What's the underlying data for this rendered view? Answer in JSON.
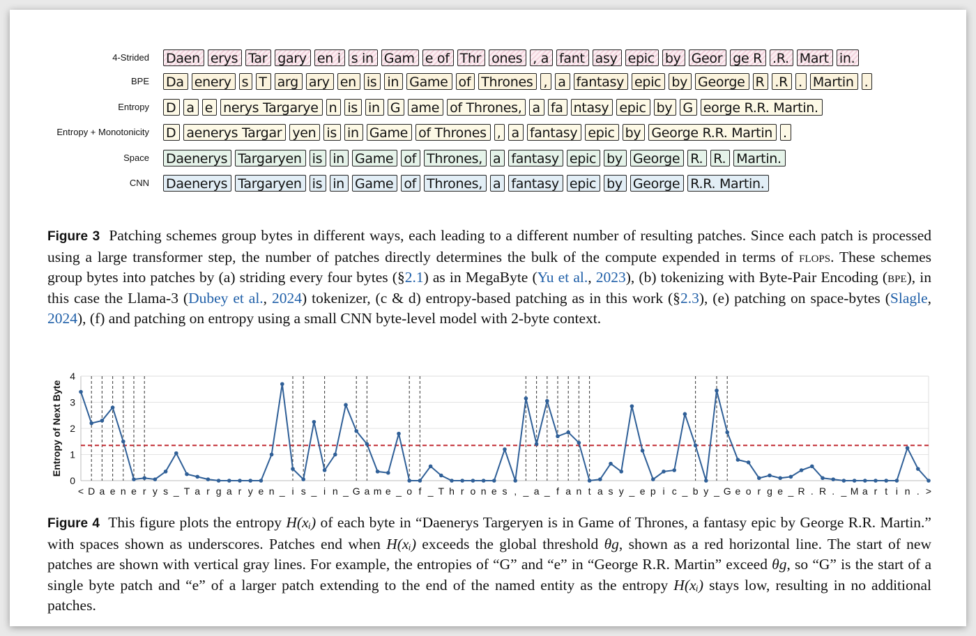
{
  "figure3": {
    "rows": [
      {
        "label": "4-Strided",
        "style": "pink",
        "tokens": [
          "Daen",
          "erys",
          "Tar",
          "gary",
          "en i",
          "s in",
          "Gam",
          "e of",
          "Thr",
          "ones",
          ", a",
          "fant",
          "asy",
          "epic",
          "by",
          "Geor",
          "ge R",
          ".R.",
          "Mart",
          "in."
        ]
      },
      {
        "label": "BPE",
        "style": "cream",
        "tokens": [
          "Da",
          "enery",
          "s",
          "T",
          "arg",
          "ary",
          "en",
          "is",
          "in",
          "Game",
          "of",
          "Thrones",
          ",",
          "a",
          "fantasy",
          "epic",
          "by",
          "George",
          "R",
          ".R",
          ".",
          "Martin",
          "."
        ]
      },
      {
        "label": "Entropy",
        "style": "yellowish",
        "tokens": [
          "D",
          "a",
          "e",
          "nerys Targarye",
          "n",
          "is",
          "in",
          "G",
          "ame",
          "of Thrones,",
          "a",
          "fa",
          "ntasy",
          "epic",
          "by",
          "G",
          "eorge R.R. Martin."
        ]
      },
      {
        "label": "Entropy + Monotonicity",
        "style": "yellowish",
        "tokens": [
          "D",
          "aenerys Targar",
          "yen",
          "is",
          "in",
          "Game",
          "of Thrones",
          ",",
          "a",
          "fantasy",
          "epic",
          "by",
          "George R.R. Martin",
          "."
        ]
      },
      {
        "label": "Space",
        "style": "mint",
        "tokens": [
          "Daenerys",
          "Targaryen",
          "is",
          "in",
          "Game",
          "of",
          "Thrones,",
          "a",
          "fantasy",
          "epic",
          "by",
          "George",
          "R.",
          "R.",
          "Martin."
        ]
      },
      {
        "label": "CNN",
        "style": "blue",
        "tokens": [
          "Daenerys",
          "Targaryen",
          "is",
          "in",
          "Game",
          "of",
          "Thrones,",
          "a",
          "fantasy",
          "epic",
          "by",
          "George",
          "R.R. Martin."
        ]
      }
    ],
    "caption": {
      "label": "Figure 3",
      "p1": "Patching schemes group bytes in different ways, each leading to a different number of resulting patches. Since each patch is processed using a large transformer step, the number of patches directly determines the bulk of the compute expended in terms of ",
      "flops": "flops",
      "p2": ". These schemes group bytes into patches by (a) striding every four bytes (§",
      "ref1": "2.1",
      "p3": ") as in MegaByte (",
      "cite1": "Yu et al.",
      "p4": ", ",
      "cite1y": "2023",
      "p5": "), (b) tokenizing with Byte-Pair Encoding (",
      "bpe": "bpe",
      "p6": "), in this case the Llama-3 (",
      "cite2": "Dubey et al.",
      "p7": ", ",
      "cite2y": "2024",
      "p8": ") tokenizer, (c & d) entropy-based patching as in this work (§",
      "ref2": "2.3",
      "p9": "), (e) patching on space-bytes (",
      "cite3": "Slagle",
      "p10": ", ",
      "cite3y": "2024",
      "p11": "), (f) and patching on entropy using a small CNN byte-level model with 2-byte context."
    }
  },
  "figure4": {
    "caption": {
      "label": "Figure 4",
      "p1": "This figure plots the entropy ",
      "m1": "H(xᵢ)",
      "p2": " of each byte in “Daenerys Targeryen is in Game of Thrones, a fantasy epic by George R.R. Martin.” with spaces shown as underscores. Patches end when ",
      "m2": "H(xᵢ)",
      "p3": " exceeds the global threshold ",
      "m3": "θg",
      "p4": ", shown as a red horizontal line. The start of new patches are shown with vertical gray lines. For example, the entropies of “G” and “e” in “George R.R. Martin” exceed ",
      "m4": "θg",
      "p5": ", so “G” is the start of a single byte patch and “e” of a larger patch extending to the end of the named entity as the entropy ",
      "m5": "H(xᵢ)",
      "p6": " stays low, resulting in no additional patches."
    }
  },
  "chart_data": {
    "type": "line",
    "title": "",
    "xlabel": "",
    "ylabel": "Entropy of Next Byte",
    "ylim": [
      0,
      4
    ],
    "yticks": [
      0,
      1,
      2,
      3,
      4
    ],
    "threshold": 1.35,
    "colors": {
      "line": "#2f5f97",
      "threshold": "#c0262d",
      "patch_lines": "#444444",
      "grid": "#e3e3e3"
    },
    "x": [
      "<",
      "D",
      "a",
      "e",
      "n",
      "e",
      "r",
      "y",
      "s",
      "_",
      "T",
      "a",
      "r",
      "g",
      "a",
      "r",
      "y",
      "e",
      "n",
      "_",
      "i",
      "s",
      "_",
      "i",
      "n",
      "_",
      "G",
      "a",
      "m",
      "e",
      "_",
      "o",
      "f",
      "_",
      "T",
      "h",
      "r",
      "o",
      "n",
      "e",
      "s",
      ",",
      "_",
      "a",
      "_",
      "f",
      "a",
      "n",
      "t",
      "a",
      "s",
      "y",
      "_",
      "e",
      "p",
      "i",
      "c",
      "_",
      "b",
      "y",
      "_",
      "G",
      "e",
      "o",
      "r",
      "g",
      "e",
      "_",
      "R",
      ".",
      "R",
      ".",
      "_",
      "M",
      "a",
      "r",
      "t",
      "i",
      "n",
      ".",
      ">"
    ],
    "values": [
      3.4,
      2.2,
      2.3,
      2.8,
      1.5,
      0.05,
      0.1,
      0.05,
      0.35,
      1.05,
      0.25,
      0.15,
      0.05,
      0.0,
      0.0,
      0.0,
      0.0,
      0.0,
      1.0,
      3.7,
      0.45,
      0.05,
      2.25,
      0.4,
      1.0,
      2.9,
      1.9,
      1.4,
      0.35,
      0.3,
      1.8,
      0.0,
      0.0,
      0.55,
      0.2,
      0.0,
      0.0,
      0.0,
      0.0,
      0.0,
      1.2,
      0.0,
      3.15,
      1.4,
      3.05,
      1.7,
      1.85,
      1.45,
      0.0,
      0.05,
      0.65,
      0.35,
      2.85,
      1.15,
      0.05,
      0.35,
      0.4,
      2.55,
      1.35,
      0.0,
      3.45,
      1.85,
      0.8,
      0.7,
      0.1,
      0.2,
      0.1,
      0.15,
      0.4,
      0.55,
      0.1,
      0.05,
      0.0,
      0.0,
      0.0,
      0.0,
      0.0,
      0.0,
      1.25,
      0.45,
      0.0
    ],
    "patch_starts": [
      1,
      2,
      3,
      4,
      5,
      6,
      20,
      21,
      23,
      26,
      27,
      31,
      32,
      42,
      43,
      44,
      45,
      46,
      47,
      48,
      58,
      60,
      61
    ]
  }
}
